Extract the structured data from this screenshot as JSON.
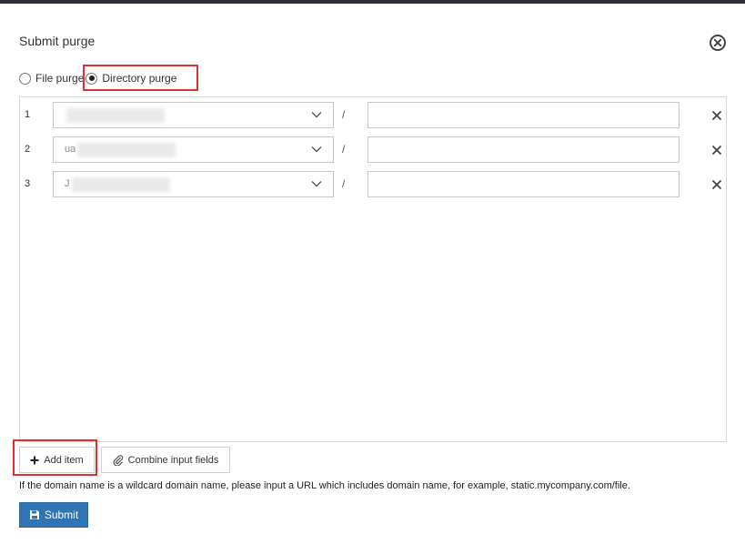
{
  "dialog": {
    "title": "Submit purge"
  },
  "purge_type": {
    "options": [
      {
        "label": "File purge",
        "checked": false
      },
      {
        "label": "Directory purge",
        "checked": true
      }
    ]
  },
  "rows": [
    {
      "index": "1",
      "domain": "",
      "separator": "/",
      "path": ""
    },
    {
      "index": "2",
      "domain": "ua",
      "separator": "/",
      "path": ""
    },
    {
      "index": "3",
      "domain": "J",
      "separator": "/",
      "path": ""
    }
  ],
  "buttons": {
    "add_item": "Add item",
    "combine": "Combine input fields",
    "submit": "Submit"
  },
  "hint": "If the domain name is a wildcard domain name, please input a URL which includes domain name, for example, static.mycompany.com/file.",
  "icons": {
    "close": "close-circle-icon",
    "chevron": "chevron-down-icon",
    "delete": "close-icon",
    "add": "plus-icon",
    "combine": "paperclip-icon",
    "submit": "save-icon"
  },
  "colors": {
    "highlight": "#e03131",
    "primary": "#2f74b5"
  }
}
